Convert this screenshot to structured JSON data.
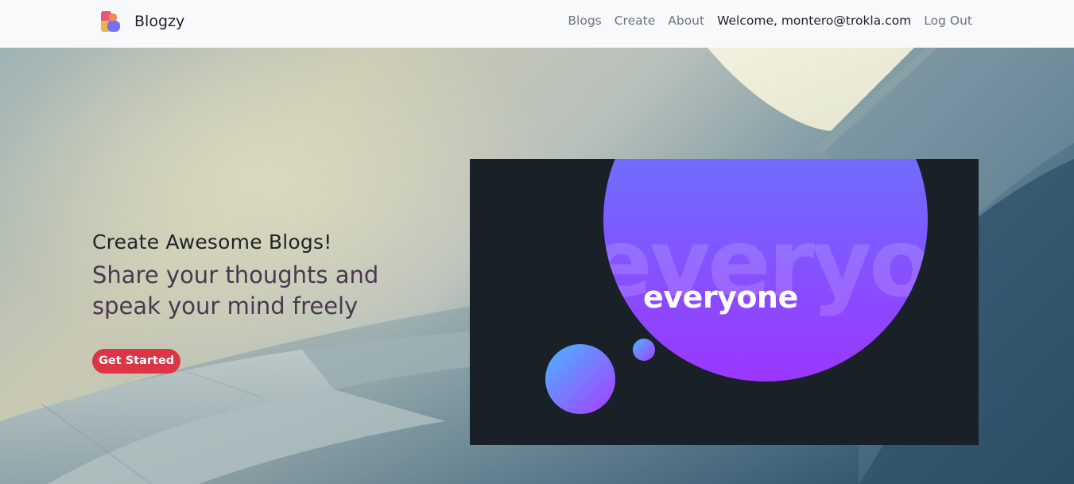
{
  "navbar": {
    "brand_name": "Blogzy",
    "links": {
      "blogs": "Blogs",
      "create": "Create",
      "about": "About",
      "welcome": "Welcome, montero@trokla.com",
      "logout": "Log Out"
    }
  },
  "hero": {
    "heading": "Create Awesome Blogs!",
    "subheading": "Share your thoughts and speak your mind freely",
    "cta_label": "Get Started",
    "illustration": {
      "word": "everyone",
      "ghost_word": "everyone"
    }
  },
  "colors": {
    "navbar_bg": "#f8f9fa",
    "cta_bg": "#dc3545",
    "subheading": "#4a3851",
    "illustration_bg": "#1a2027",
    "circle_top": "#5b86ff",
    "circle_bottom": "#9b36ff"
  },
  "icons": {
    "brand_logo": "blogzy-logo-icon"
  }
}
